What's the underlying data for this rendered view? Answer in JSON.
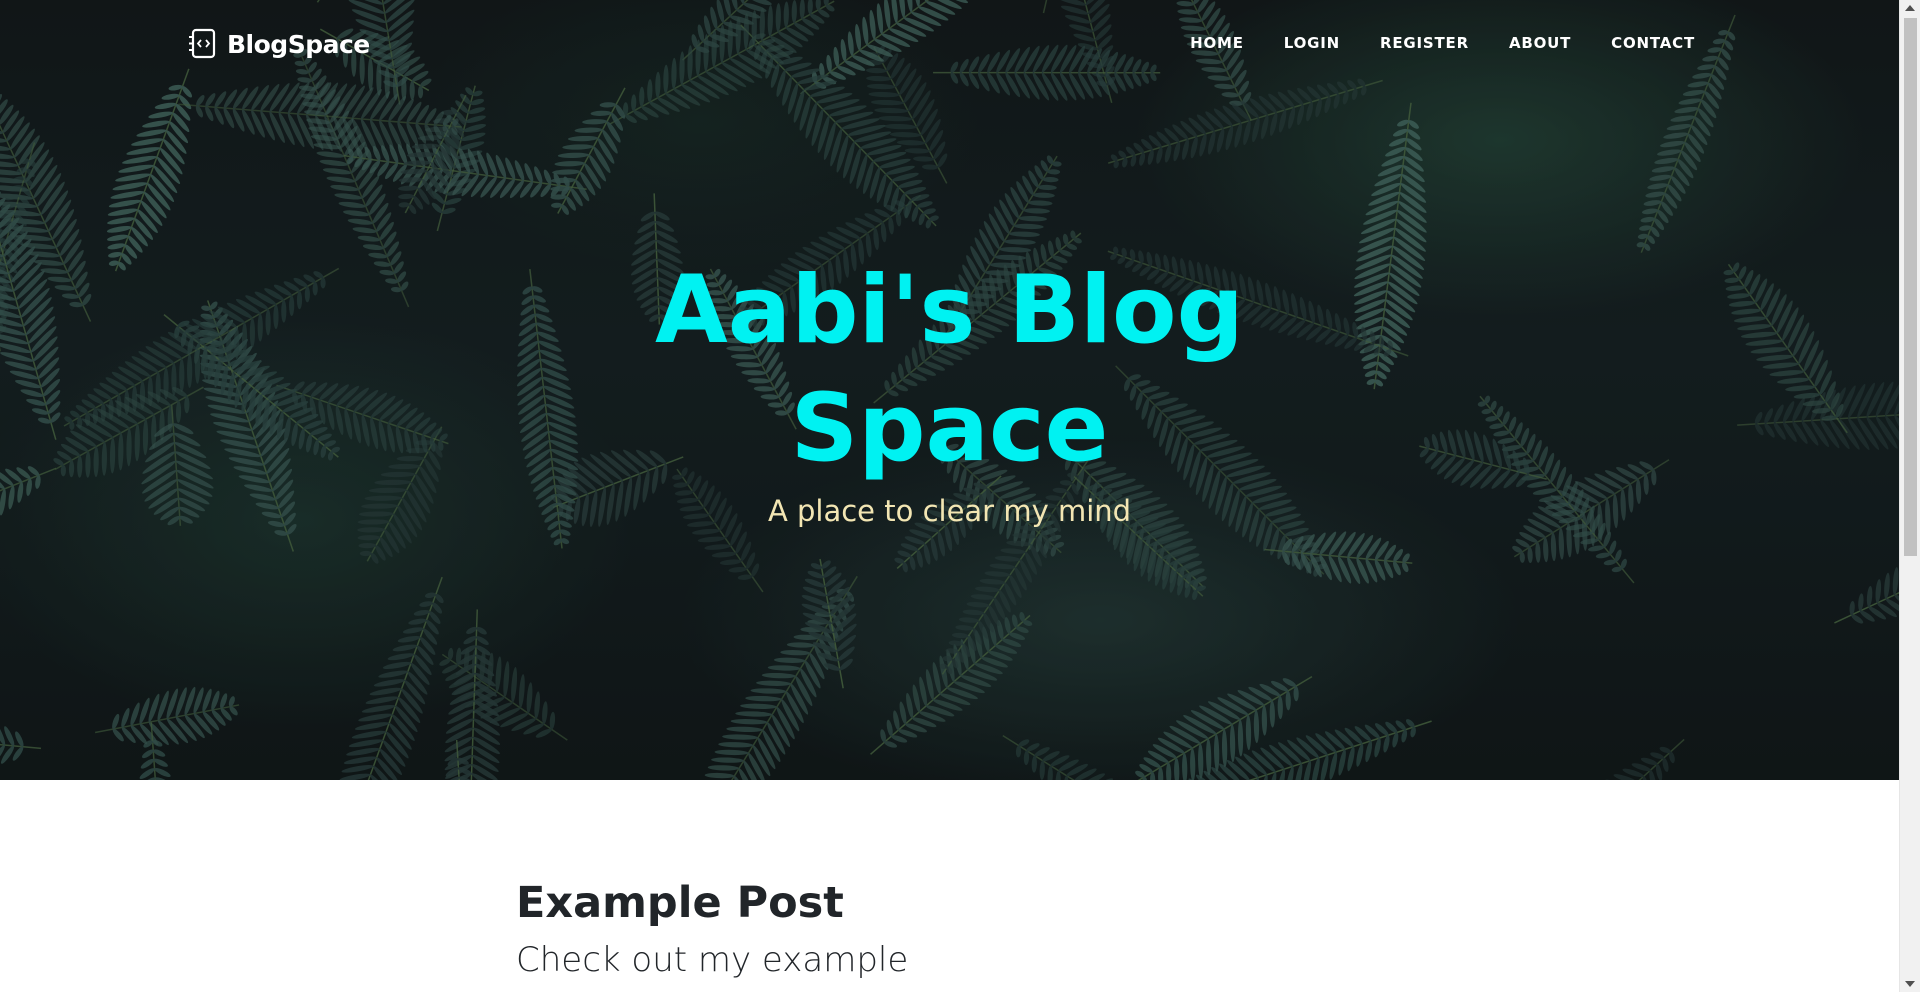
{
  "nav": {
    "brand": "BlogSpace",
    "brand_icon": "notebook-code-icon",
    "links": [
      "HOME",
      "LOGIN",
      "REGISTER",
      "ABOUT",
      "CONTACT"
    ]
  },
  "hero": {
    "title_line1": "Aabi's Blog",
    "title_line2": "Space",
    "subtitle": "A place to clear my mind"
  },
  "post": {
    "title": "Example Post",
    "subtitle": "Check out my example"
  },
  "colors": {
    "hero_title": "#00f2f2",
    "hero_subtitle": "#f3e6b3",
    "nav_text": "#ffffff",
    "body_text": "#212529"
  }
}
